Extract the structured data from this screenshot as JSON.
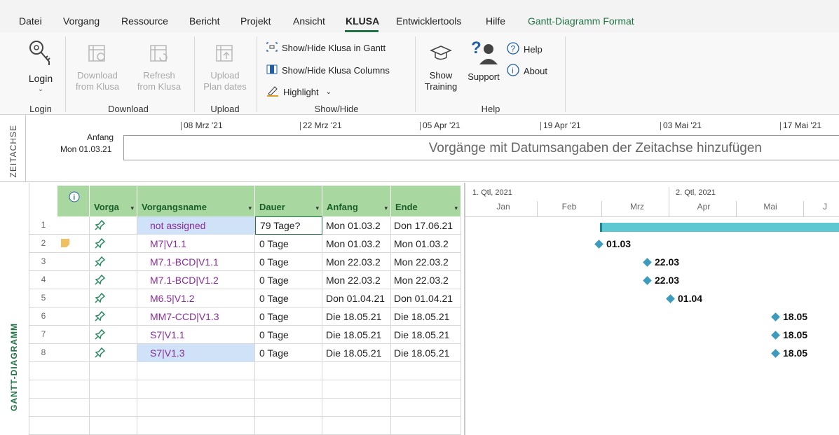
{
  "menu": {
    "tabs": [
      "Datei",
      "Vorgang",
      "Ressource",
      "Bericht",
      "Projekt",
      "Ansicht",
      "KLUSA",
      "Entwicklertools",
      "Hilfe",
      "Gantt-Diagramm Format"
    ],
    "active": "KLUSA"
  },
  "ribbon": {
    "login": {
      "label": "Login",
      "group": "Login"
    },
    "download": {
      "btn1": "Download",
      "btn1b": "from Klusa",
      "btn2": "Refresh",
      "btn2b": "from Klusa",
      "group": "Download"
    },
    "upload": {
      "btn": "Upload",
      "btnb": "Plan dates",
      "group": "Upload"
    },
    "showhide": {
      "gantt": "Show/Hide Klusa in Gantt",
      "columns": "Show/Hide Klusa Columns",
      "highlight": "Highlight",
      "group": "Show/Hide"
    },
    "help": {
      "training": "Show",
      "trainingb": "Training",
      "support": "Support",
      "help": "Help",
      "about": "About",
      "group": "Help"
    }
  },
  "timeline": {
    "side_label": "ZEITACHSE",
    "start_label": "Anfang",
    "start_date": "Mon 01.03.21",
    "ticks": [
      "08 Mrz '21",
      "22 Mrz '21",
      "05 Apr '21",
      "19 Apr '21",
      "03 Mai '21",
      "17 Mai '21"
    ],
    "placeholder": "Vorgänge mit Datumsangaben der Zeitachse hinzufügen"
  },
  "gantt": {
    "side_label": "GANTT-DIAGRAMM",
    "headers": {
      "mode": "Vorga",
      "name": "Vorgangsname",
      "duration": "Dauer",
      "start": "Anfang",
      "end": "Ende"
    },
    "rows": [
      {
        "num": "1",
        "name": "not assigned",
        "duration": "79 Tage?",
        "start": "Mon 01.03.2",
        "end": "Don 17.06.21"
      },
      {
        "num": "2",
        "name": "M7|V1.1",
        "duration": "0 Tage",
        "start": "Mon 01.03.2",
        "end": "Mon 01.03.2"
      },
      {
        "num": "3",
        "name": "M7.1-BCD|V1.1",
        "duration": "0 Tage",
        "start": "Mon 22.03.2",
        "end": "Mon 22.03.2"
      },
      {
        "num": "4",
        "name": "M7.1-BCD|V1.2",
        "duration": "0 Tage",
        "start": "Mon 22.03.2",
        "end": "Mon 22.03.2"
      },
      {
        "num": "5",
        "name": "M6.5|V1.2",
        "duration": "0 Tage",
        "start": "Don 01.04.21",
        "end": "Don 01.04.21"
      },
      {
        "num": "6",
        "name": "MM7-CCD|V1.3",
        "duration": "0 Tage",
        "start": "Die 18.05.21",
        "end": "Die 18.05.21"
      },
      {
        "num": "7",
        "name": "S7|V1.1",
        "duration": "0 Tage",
        "start": "Die 18.05.21",
        "end": "Die 18.05.21"
      },
      {
        "num": "8",
        "name": "S7|V1.3",
        "duration": "0 Tage",
        "start": "Die 18.05.21",
        "end": "Die 18.05.21"
      }
    ],
    "chart": {
      "quarters": [
        "1. Qtl, 2021",
        "2. Qtl, 2021"
      ],
      "months": [
        "Jan",
        "Feb",
        "Mrz",
        "Apr",
        "Mai",
        "J"
      ],
      "milestones": [
        "01.03",
        "22.03",
        "22.03",
        "01.04",
        "18.05",
        "18.05",
        "18.05"
      ]
    }
  },
  "colors": {
    "accent": "#217346",
    "header_green": "#a8d8a0",
    "bar": "#5ec8d2",
    "milestone": "#3e9bc0",
    "task_name": "#8b2c9e"
  }
}
